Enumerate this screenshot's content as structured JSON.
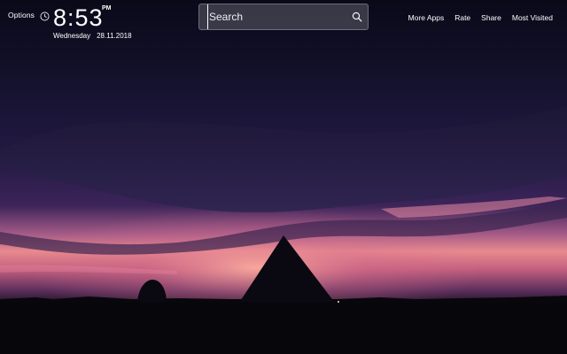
{
  "header": {
    "options_label": "Options",
    "clock": {
      "time": "8:53",
      "period": "PM",
      "weekday": "Wednesday",
      "date": "28.11.2018"
    }
  },
  "search": {
    "placeholder": "Search",
    "value": ""
  },
  "nav": {
    "items": [
      {
        "label": "More Apps"
      },
      {
        "label": "Rate"
      },
      {
        "label": "Share"
      },
      {
        "label": "Most Visited"
      }
    ]
  },
  "icons": {
    "options": "clock-icon",
    "search": "search-icon"
  },
  "colors": {
    "sky_top": "#0d0b1e",
    "sky_mid": "#2c1d4f",
    "horizon_glow": "#ff9a8c",
    "ground": "#06050a"
  }
}
